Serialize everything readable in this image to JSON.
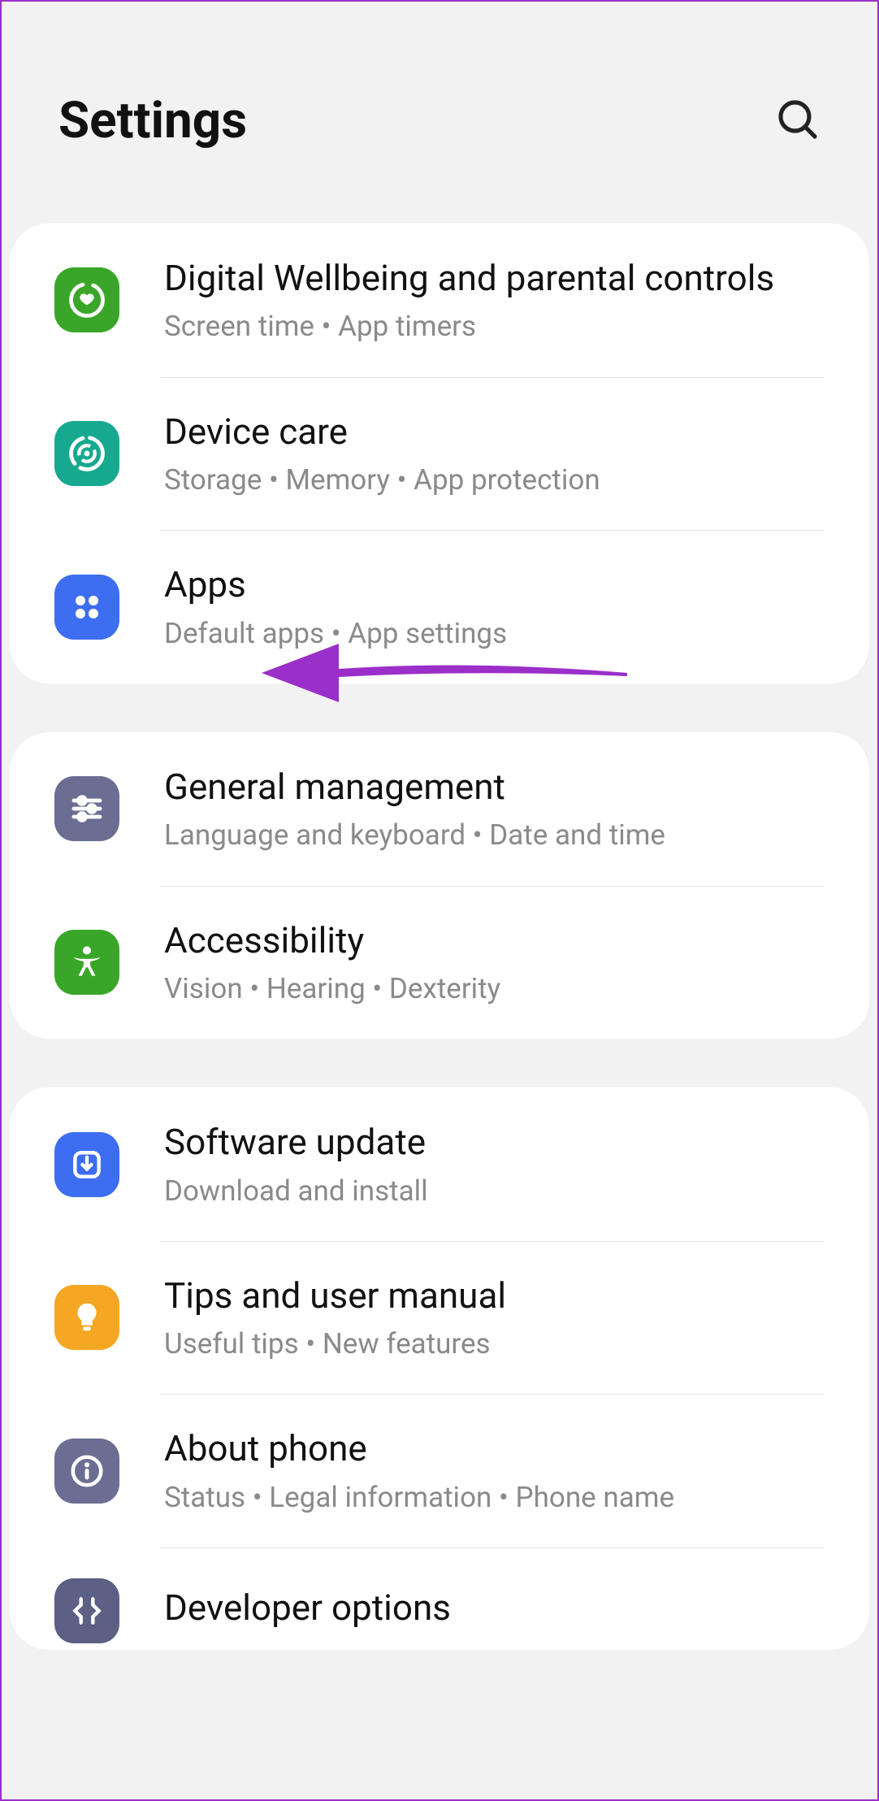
{
  "header": {
    "title": "Settings"
  },
  "sections": [
    {
      "items": [
        {
          "key": "wellbeing",
          "title": "Digital Wellbeing and parental controls",
          "sub": "Screen time  •  App timers"
        },
        {
          "key": "devicecare",
          "title": "Device care",
          "sub": "Storage  •  Memory  •  App protection"
        },
        {
          "key": "apps",
          "title": "Apps",
          "sub": "Default apps  •  App settings"
        }
      ]
    },
    {
      "items": [
        {
          "key": "general",
          "title": "General management",
          "sub": "Language and keyboard  •  Date and time"
        },
        {
          "key": "accessibility",
          "title": "Accessibility",
          "sub": "Vision  •  Hearing  •  Dexterity"
        }
      ]
    },
    {
      "items": [
        {
          "key": "software",
          "title": "Software update",
          "sub": "Download and install"
        },
        {
          "key": "tips",
          "title": "Tips and user manual",
          "sub": "Useful tips  •  New features"
        },
        {
          "key": "about",
          "title": "About phone",
          "sub": "Status  •  Legal information  •  Phone name"
        },
        {
          "key": "developer",
          "title": "Developer options",
          "sub": ""
        }
      ]
    }
  ],
  "annotation": {
    "arrow_target": "apps"
  }
}
